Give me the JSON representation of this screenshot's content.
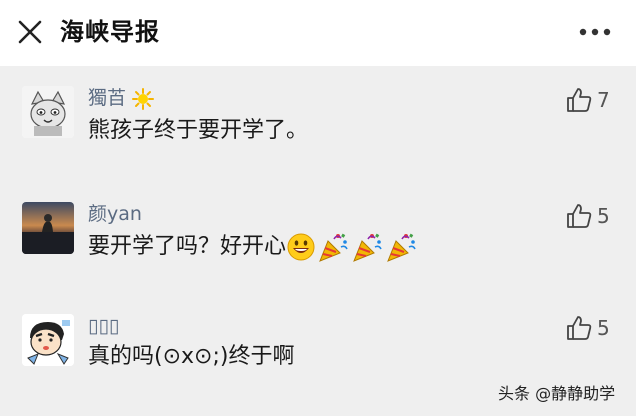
{
  "header": {
    "title": "海峡导报",
    "close_icon": "close-icon",
    "more_icon": "more-dots-icon"
  },
  "comments": [
    {
      "username": "獨苩",
      "username_badge": "sun-emoji-icon",
      "text": "熊孩子终于要开学了。",
      "like_count": "7",
      "avatar": "cat-cartoon-avatar"
    },
    {
      "username": "颜yan",
      "text": "要开学了吗？好开心",
      "emojis": [
        "smile-emoji-icon",
        "party-popper-icon",
        "party-popper-icon",
        "party-popper-icon"
      ],
      "like_count": "5",
      "avatar": "sunset-photo-avatar"
    },
    {
      "username": "▯▯▯",
      "text": "真的吗(⊙x⊙;)终于啊",
      "like_count": "5",
      "avatar": "crayon-shin-chan-avatar"
    }
  ],
  "watermark": "头条 @静静助学",
  "colors": {
    "username": "#5b6b82",
    "background": "#efefef",
    "header_bg": "#ffffff"
  }
}
